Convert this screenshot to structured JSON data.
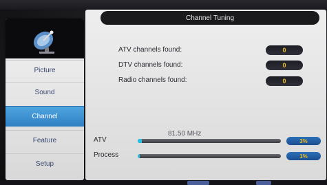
{
  "title": "Channel Tuning",
  "sidebar": {
    "logo_icon": "satellite-dish-icon",
    "items": [
      {
        "label": "Picture",
        "active": false
      },
      {
        "label": "Sound",
        "active": false
      },
      {
        "label": "Channel",
        "active": true
      },
      {
        "label": "Feature",
        "active": false
      },
      {
        "label": "Setup",
        "active": false
      }
    ]
  },
  "results": [
    {
      "label": "ATV channels found:",
      "value": "0"
    },
    {
      "label": "DTV channels found:",
      "value": "0"
    },
    {
      "label": "Radio channels found:",
      "value": "0"
    }
  ],
  "frequency": "81.50 MHz",
  "progress": [
    {
      "label": "ATV",
      "percent_text": "3%",
      "fraction": 0.03
    },
    {
      "label": "Process",
      "percent_text": "1%",
      "fraction": 0.01
    }
  ],
  "colors": {
    "active_tab": "#2f7fc2",
    "count_text": "#f0c020",
    "bar_fill": "#28c0e0"
  }
}
